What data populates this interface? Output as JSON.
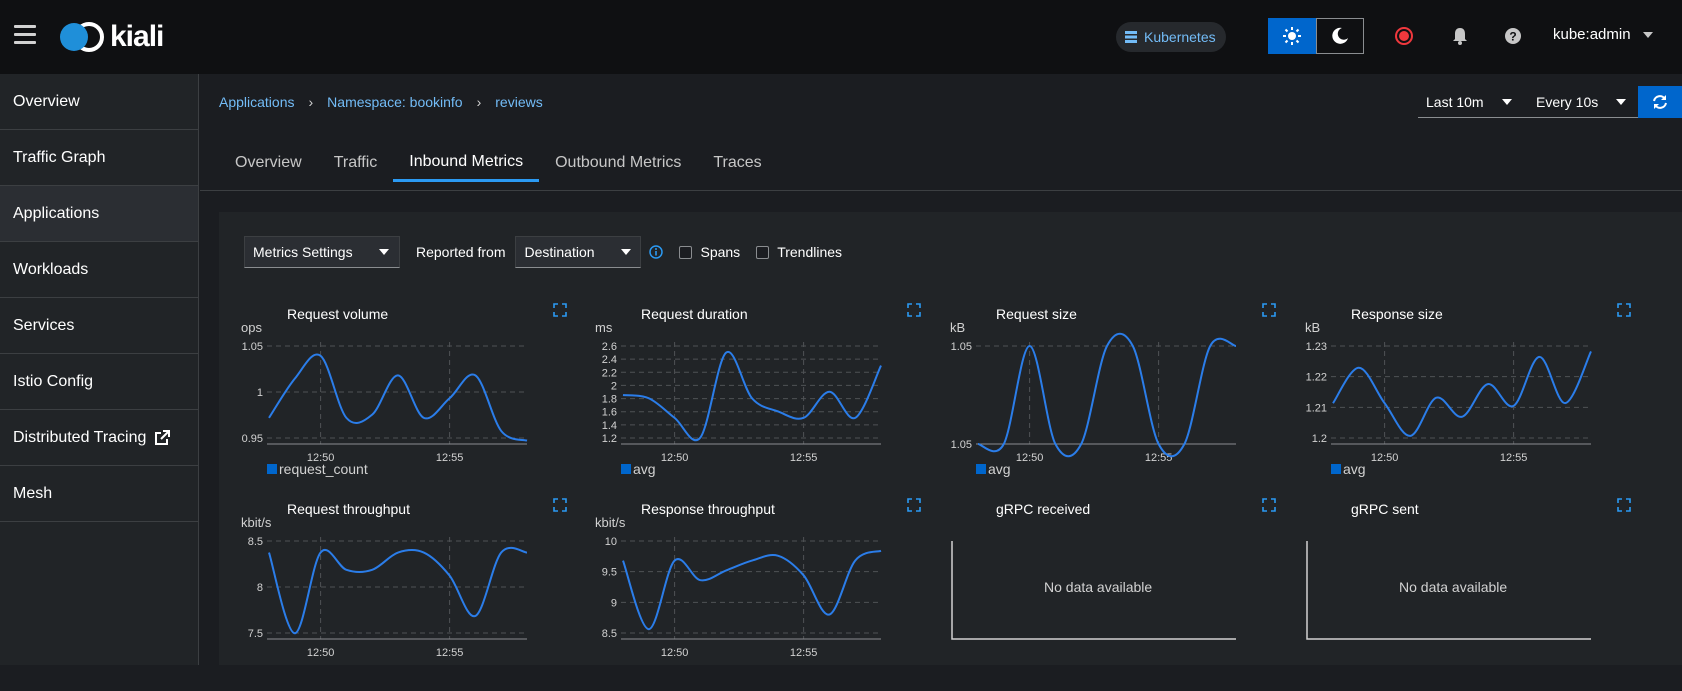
{
  "header": {
    "logo_text": "kiali",
    "cluster_label": "Kubernetes",
    "user": "kube:admin",
    "accent": "#0066cc"
  },
  "sidebar": {
    "items": [
      {
        "label": "Overview"
      },
      {
        "label": "Traffic Graph"
      },
      {
        "label": "Applications",
        "active": true
      },
      {
        "label": "Workloads"
      },
      {
        "label": "Services"
      },
      {
        "label": "Istio Config"
      },
      {
        "label": "Distributed Tracing",
        "icon": "external-link-icon"
      },
      {
        "label": "Mesh"
      }
    ]
  },
  "breadcrumb": [
    "Applications",
    "Namespace: bookinfo",
    "reviews"
  ],
  "time_controls": {
    "range": "Last 10m",
    "refresh": "Every 10s"
  },
  "tabs": [
    "Overview",
    "Traffic",
    "Inbound Metrics",
    "Outbound Metrics",
    "Traces"
  ],
  "active_tab": "Inbound Metrics",
  "toolbar": {
    "metrics_settings": "Metrics Settings",
    "reported_from_label": "Reported from",
    "reported_from_value": "Destination",
    "spans_label": "Spans",
    "trendlines_label": "Trendlines"
  },
  "no_data_text": "No data available",
  "chart_data": [
    {
      "type": "line",
      "title": "Request volume",
      "ylabel": "ops",
      "series": [
        {
          "name": "request_count",
          "x": [
            "12:48",
            "12:49",
            "12:50",
            "12:51",
            "12:52",
            "12:53",
            "12:54",
            "12:55",
            "12:56",
            "12:57",
            "12:58"
          ],
          "values": [
            0.97,
            1.03,
            1.065,
            0.97,
            0.975,
            1.035,
            0.97,
            1.0,
            1.035,
            0.95,
            0.935
          ]
        }
      ],
      "yticks": [
        "1.05",
        "1",
        "0.95"
      ],
      "xticks": [
        "12:50",
        "12:55"
      ],
      "ylim": [
        0.93,
        1.08
      ]
    },
    {
      "type": "line",
      "title": "Request duration",
      "ylabel": "ms",
      "series": [
        {
          "name": "avg",
          "x": [
            "12:48",
            "12:49",
            "12:50",
            "12:51",
            "12:52",
            "12:53",
            "12:54",
            "12:55",
            "12:56",
            "12:57",
            "12:58"
          ],
          "values": [
            1.95,
            1.9,
            1.6,
            1.3,
            2.6,
            1.9,
            1.7,
            1.6,
            2.0,
            1.6,
            2.4
          ]
        }
      ],
      "yticks": [
        "2.6",
        "2.4",
        "2.2",
        "2",
        "1.8",
        "1.6",
        "1.4",
        "1.2"
      ],
      "xticks": [
        "12:50",
        "12:55"
      ],
      "ylim": [
        1.2,
        2.7
      ]
    },
    {
      "type": "line",
      "title": "Request size",
      "ylabel": "kB",
      "series": [
        {
          "name": "avg",
          "x": [
            "12:48",
            "12:49",
            "12:50",
            "12:51",
            "12:52",
            "12:53",
            "12:54",
            "12:55",
            "12:56",
            "12:57",
            "12:58"
          ],
          "values": [
            0,
            0,
            1,
            0,
            0,
            1,
            1,
            0,
            0,
            1,
            1
          ]
        }
      ],
      "yticks": [
        "1.05",
        "1.05"
      ],
      "xticks": [
        "12:50",
        "12:55"
      ],
      "ylim": [
        0,
        1
      ]
    },
    {
      "type": "line",
      "title": "Response size",
      "ylabel": "kB",
      "series": [
        {
          "name": "avg",
          "x": [
            "12:48",
            "12:49",
            "12:50",
            "12:51",
            "12:52",
            "12:53",
            "12:54",
            "12:55",
            "12:56",
            "12:57",
            "12:58"
          ],
          "values": [
            1.215,
            1.228,
            1.215,
            1.203,
            1.217,
            1.21,
            1.222,
            1.214,
            1.232,
            1.215,
            1.234
          ]
        }
      ],
      "yticks": [
        "1.23",
        "1.22",
        "1.21",
        "1.2"
      ],
      "xticks": [
        "12:50",
        "12:55"
      ],
      "ylim": [
        1.2,
        1.236
      ]
    },
    {
      "type": "line",
      "title": "Request throughput",
      "ylabel": "kbit/s",
      "series": [
        {
          "x": [
            "12:48",
            "12:49",
            "12:50",
            "12:51",
            "12:52",
            "12:53",
            "12:54",
            "12:55",
            "12:56",
            "12:57",
            "12:58"
          ],
          "values": [
            8.7,
            7.3,
            8.7,
            8.4,
            8.4,
            8.7,
            8.7,
            8.3,
            7.6,
            8.7,
            8.7
          ]
        }
      ],
      "yticks": [
        "8.5",
        "8",
        "7.5"
      ],
      "xticks": [
        "12:50",
        "12:55"
      ],
      "ylim": [
        7.2,
        8.9
      ]
    },
    {
      "type": "line",
      "title": "Response throughput",
      "ylabel": "kbit/s",
      "series": [
        {
          "x": [
            "12:48",
            "12:49",
            "12:50",
            "12:51",
            "12:52",
            "12:53",
            "12:54",
            "12:55",
            "12:56",
            "12:57",
            "12:58"
          ],
          "values": [
            10.0,
            8.6,
            10.0,
            9.6,
            9.8,
            10.0,
            10.1,
            9.7,
            8.9,
            10.0,
            10.2
          ]
        }
      ],
      "yticks": [
        "10",
        "9.5",
        "9",
        "8.5"
      ],
      "xticks": [
        "12:50",
        "12:55"
      ],
      "ylim": [
        8.4,
        10.4
      ]
    },
    {
      "type": "line",
      "title": "gRPC received",
      "no_data": true
    },
    {
      "type": "line",
      "title": "gRPC sent",
      "no_data": true
    }
  ]
}
